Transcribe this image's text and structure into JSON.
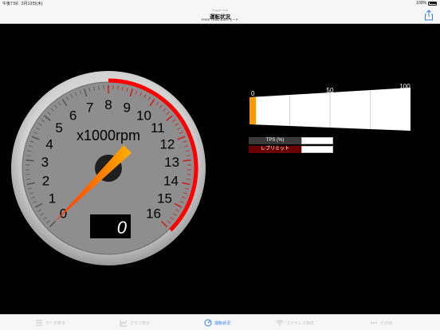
{
  "status_bar": {
    "time": "午後7:56",
    "date": "2月13日(木)",
    "battery": "100%"
  },
  "nav": {
    "super_title": "Engine Info",
    "title": "運転状況",
    "subtitle": "FREE TRIAL EASYモード"
  },
  "gauge": {
    "unit_label": "x1000rpm",
    "ticks": [
      "0",
      "1",
      "2",
      "3",
      "4",
      "5",
      "6",
      "7",
      "8",
      "9",
      "10",
      "11",
      "12",
      "13",
      "14",
      "15",
      "16"
    ],
    "redline_from": 8,
    "max": 16,
    "digital_readout": "0",
    "needle_value": 0
  },
  "tps": {
    "scale_labels": [
      "0",
      "50",
      "100"
    ],
    "value_percent": 4,
    "fill_color": "#ff9900",
    "rows": [
      {
        "label": "TPS (%)",
        "color": "#3a3a3a"
      },
      {
        "label": "レブリミット",
        "color": "#6b0000"
      }
    ]
  },
  "tabs": [
    {
      "label": "データ表示",
      "active": false
    },
    {
      "label": "グラフ表示",
      "active": false
    },
    {
      "label": "運転状況",
      "active": true
    },
    {
      "label": "ワイヤレス接続",
      "active": false
    },
    {
      "label": "その他",
      "active": false
    }
  ],
  "colors": {
    "accent": "#2f7cf6",
    "redzone": "#ff0000",
    "needle": "#ff5a00"
  }
}
